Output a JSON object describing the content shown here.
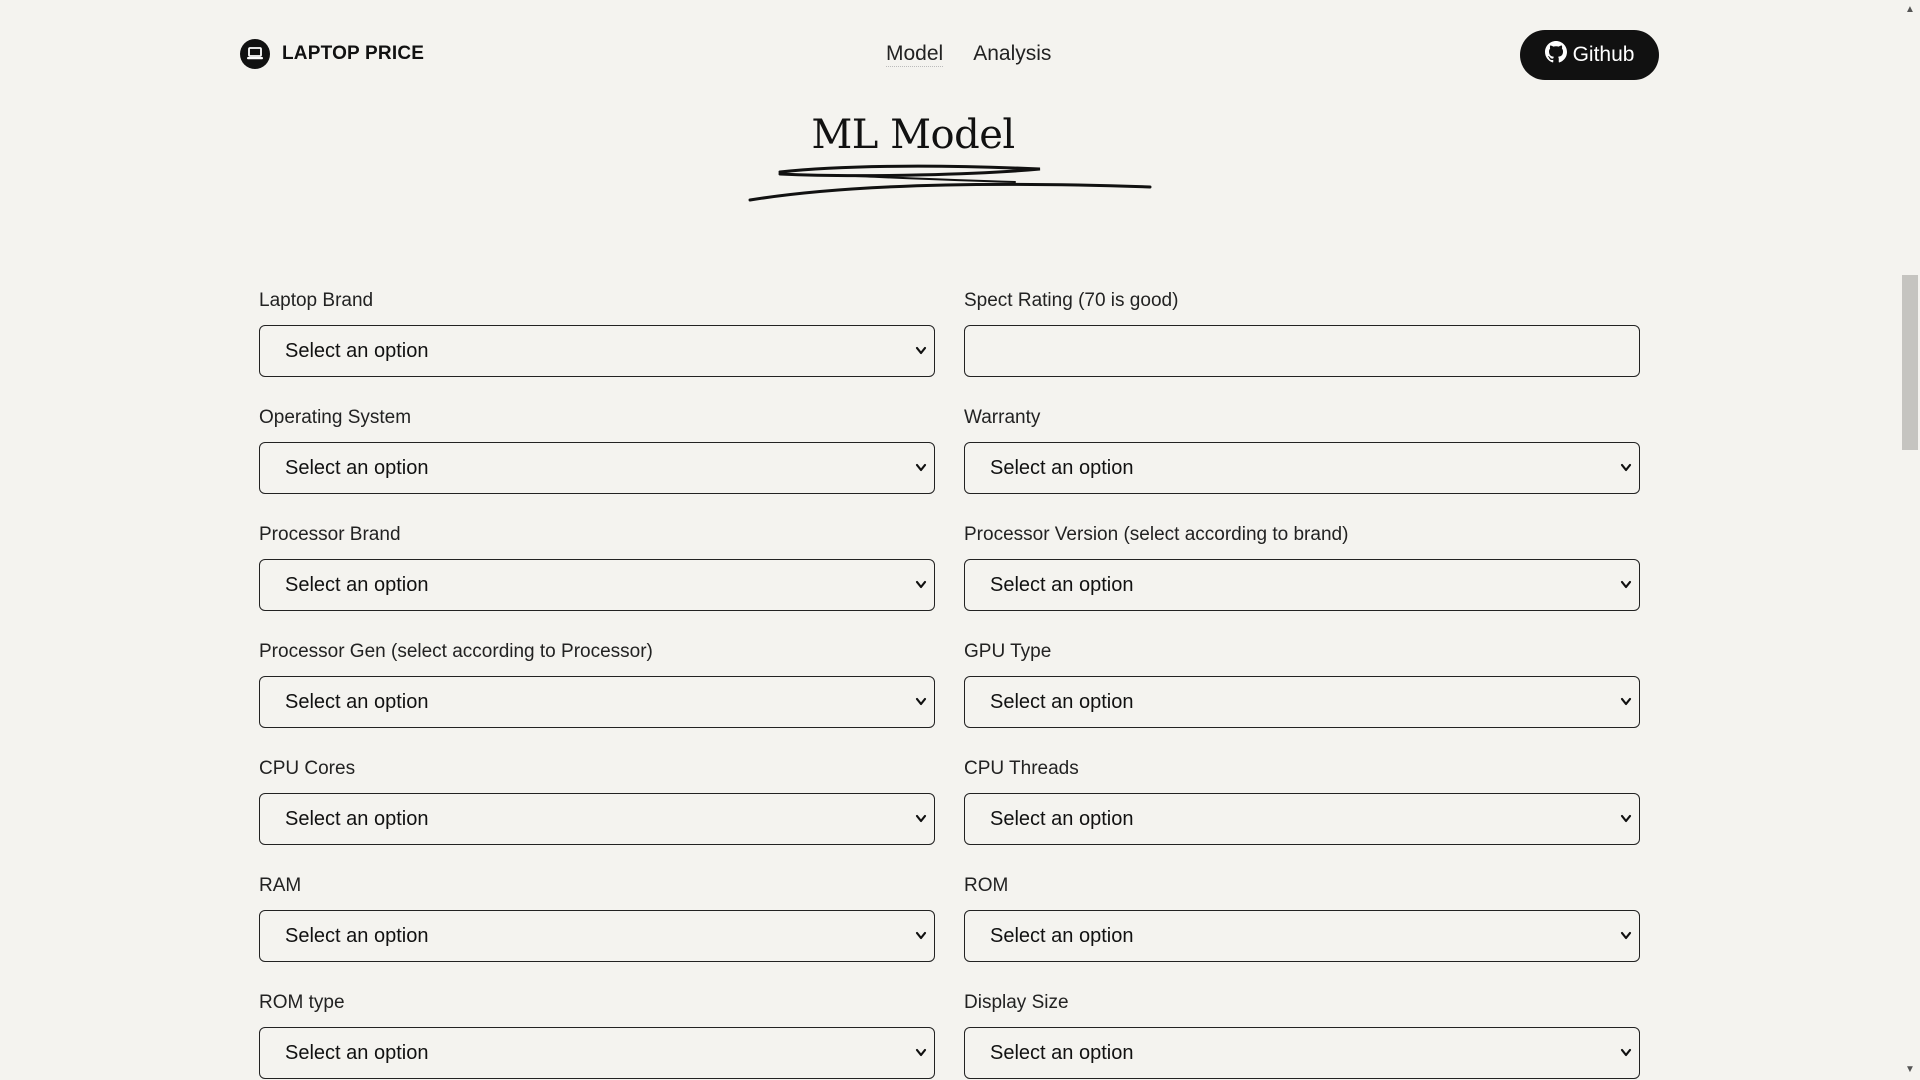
{
  "header": {
    "logo_text": "LAPTOP PRICE",
    "logo_icon": "laptop-icon",
    "nav": [
      {
        "label": "Model",
        "active": true
      },
      {
        "label": "Analysis",
        "active": false
      }
    ],
    "github_label": "Github",
    "github_icon": "github-icon"
  },
  "title": "ML Model",
  "form": {
    "fields": [
      {
        "label": "Laptop Brand",
        "type": "select",
        "value": "Select an option"
      },
      {
        "label": "Spect Rating (70 is good)",
        "type": "text",
        "value": ""
      },
      {
        "label": "Operating System",
        "type": "select",
        "value": "Select an option"
      },
      {
        "label": "Warranty",
        "type": "select",
        "value": "Select an option"
      },
      {
        "label": "Processor Brand",
        "type": "select",
        "value": "Select an option"
      },
      {
        "label": "Processor Version (select according to brand)",
        "type": "select",
        "value": "Select an option"
      },
      {
        "label": "Processor Gen (select according to Processor)",
        "type": "select",
        "value": "Select an option"
      },
      {
        "label": "GPU Type",
        "type": "select",
        "value": "Select an option"
      },
      {
        "label": "CPU Cores",
        "type": "select",
        "value": "Select an option"
      },
      {
        "label": "CPU Threads",
        "type": "select",
        "value": "Select an option"
      },
      {
        "label": "RAM",
        "type": "select",
        "value": "Select an option"
      },
      {
        "label": "ROM",
        "type": "select",
        "value": "Select an option"
      },
      {
        "label": "ROM type",
        "type": "select",
        "value": "Select an option"
      },
      {
        "label": "Display Size",
        "type": "select",
        "value": "Select an option"
      }
    ]
  },
  "colors": {
    "background": "#f4f3ef",
    "text": "#111111",
    "button_bg": "#111111",
    "button_text": "#ffffff"
  }
}
